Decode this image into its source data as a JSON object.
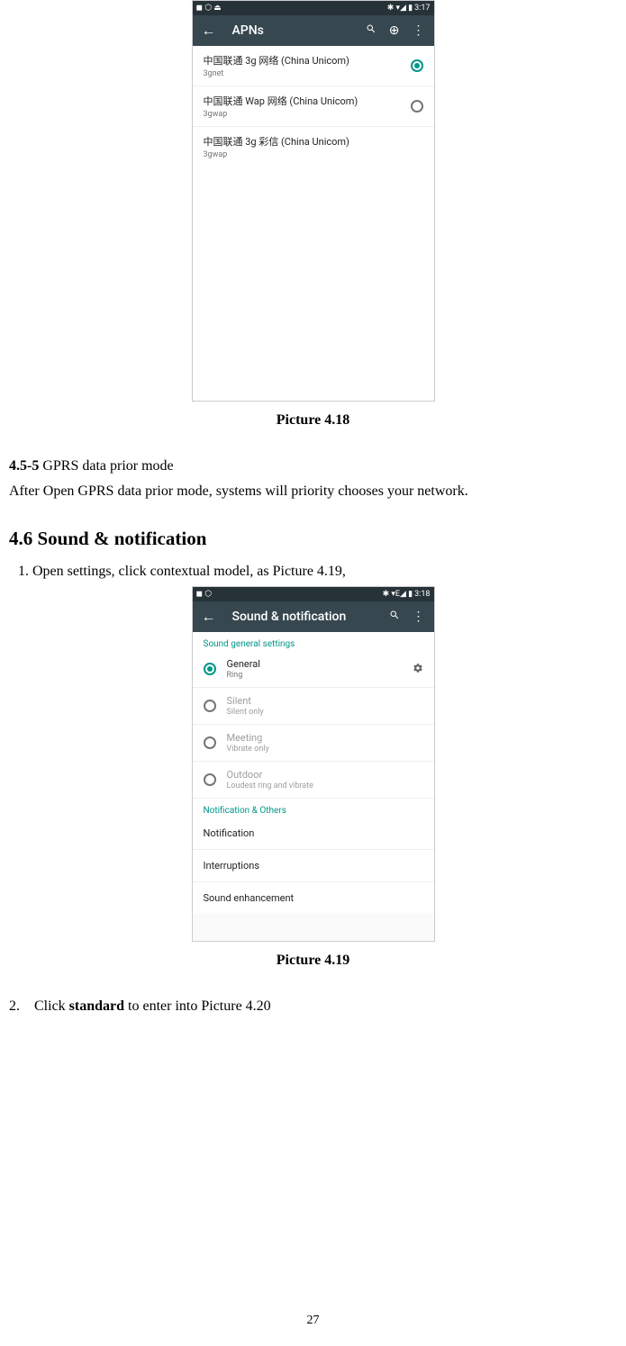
{
  "screenshot1": {
    "statusbar": {
      "time": "3:17",
      "icons_left": "◼ ⬡ ⏏",
      "icons_right": "✱ ▾◢ ▮"
    },
    "appbar": {
      "title": "APNs"
    },
    "apns": [
      {
        "title": "中国联通 3g 网络 (China Unicom)",
        "sub": "3gnet",
        "selected": true
      },
      {
        "title": "中国联通 Wap 网络 (China Unicom)",
        "sub": "3gwap",
        "selected": false
      },
      {
        "title": "中国联通 3g 彩信 (China Unicom)",
        "sub": "3gwap",
        "selected": false
      }
    ]
  },
  "caption1": "Picture 4.18",
  "gprs": {
    "num": "4.5-5",
    "title": " GPRS data prior mode",
    "body": "After Open GPRS data prior mode, systems will priority chooses your network."
  },
  "heading": "4.6 Sound & notification",
  "step1": "1. Open settings, click contextual model, as Picture 4.19,",
  "screenshot2": {
    "statusbar": {
      "time": "3:18",
      "icons_left": "◼ ⬡",
      "icons_right": "✱ ▾E◢ ▮"
    },
    "appbar": {
      "title": "Sound & notification"
    },
    "section1": "Sound general settings",
    "profiles": [
      {
        "title": "General",
        "sub": "Ring",
        "selected": true,
        "gear": true
      },
      {
        "title": "Silent",
        "sub": "Silent only",
        "selected": false,
        "gear": false
      },
      {
        "title": "Meeting",
        "sub": "Vibrate only",
        "selected": false,
        "gear": false
      },
      {
        "title": "Outdoor",
        "sub": "Loudest ring and vibrate",
        "selected": false,
        "gear": false
      }
    ],
    "section2": "Notification & Others",
    "items": [
      "Notification",
      "Interruptions",
      "Sound enhancement"
    ]
  },
  "caption2": "Picture 4.19",
  "step2": {
    "num": "2.",
    "pre": "Click ",
    "bold": "standard",
    "post": " to enter into Picture 4.20"
  },
  "pagenum": "27"
}
